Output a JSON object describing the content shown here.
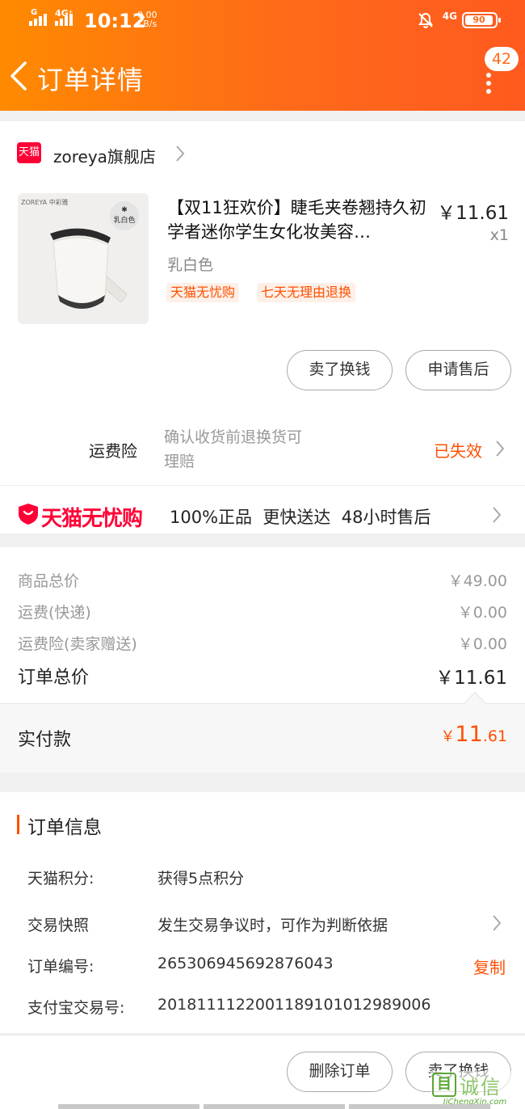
{
  "status_bar": {
    "time": "10:12",
    "net_speed": "0.00",
    "net_unit": "KB/s",
    "sim1": "G",
    "sim2": "4G⁺",
    "sim3": "4G",
    "battery": "90"
  },
  "nav": {
    "title": "订单详情",
    "message_count": "42"
  },
  "store": {
    "badge": "天猫",
    "name": "zoreya旗舰店"
  },
  "product": {
    "title": "【双11狂欢价】睫毛夹卷翘持久初学者迷你学生女化妆美容…",
    "price": "￥11.61",
    "qty": "x1",
    "sku": "乳白色",
    "image_brand": "ZOREYA",
    "image_brand_cn": "中彩雅",
    "image_color_label": "乳白色",
    "tags": [
      "天猫无忧购",
      "七天无理由退换"
    ]
  },
  "actions": {
    "sell": "卖了换钱",
    "after_sale": "申请售后"
  },
  "insurance": {
    "label": "运费险",
    "desc_line1": "确认收货前退换货可",
    "desc_line2": "理赔",
    "status": "已失效"
  },
  "promise": {
    "brand": "天猫无忧购",
    "text": "100%正品  更快送达  48小时售后"
  },
  "summary": {
    "rows": [
      {
        "label": "商品总价",
        "value": "￥49.00"
      },
      {
        "label": "运费(快递)",
        "value": "￥0.00"
      },
      {
        "label": "运费险(卖家赠送)",
        "value": "￥0.00"
      }
    ],
    "total_label": "订单总价",
    "total_value": "￥11.61",
    "paid_label": "实付款",
    "paid_symbol": "￥",
    "paid_int": "11",
    "paid_dec": ".61"
  },
  "order_info": {
    "section_title": "订单信息",
    "rows": [
      {
        "label": "天猫积分:",
        "value": "获得5点积分"
      },
      {
        "label": "交易快照",
        "value": "发生交易争议时，可作为判断依据"
      },
      {
        "label": "订单编号:",
        "value": "265306945692876043"
      },
      {
        "label": "支付宝交易号:",
        "value": "2018111122001189101012989006"
      }
    ],
    "copy": "复制"
  },
  "bottom_actions": {
    "delete": "删除订单",
    "sell": "卖了换钱"
  },
  "watermark": {
    "text": "诚信",
    "url": "JiChengXin.com"
  },
  "colors": {
    "accent": "#ff5000",
    "header_start": "#ff8a00",
    "header_end": "#ff5a1f",
    "tmall_red": "#ff0036"
  }
}
